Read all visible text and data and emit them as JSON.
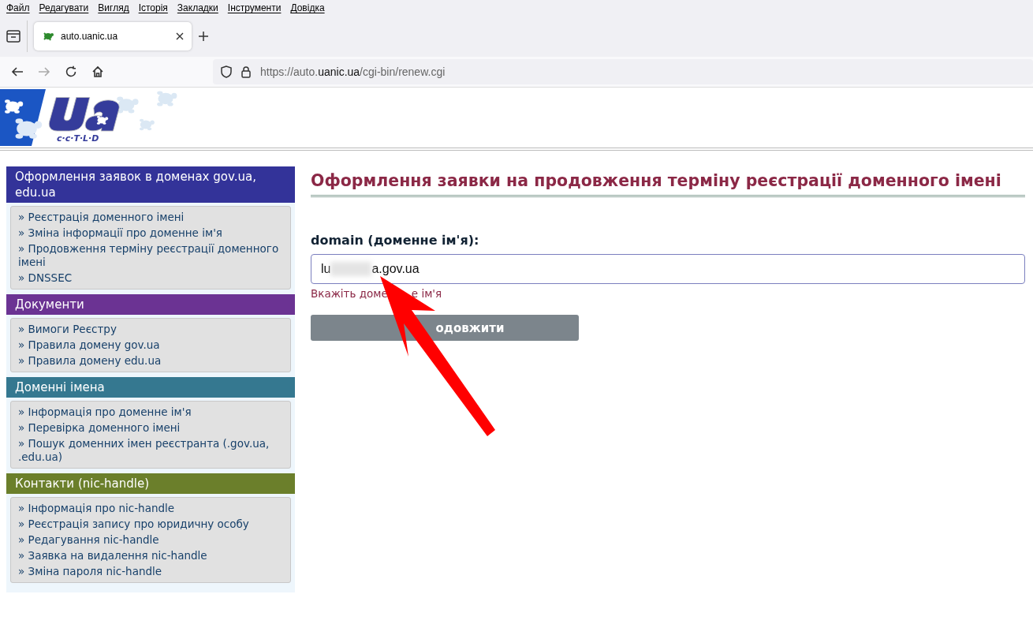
{
  "menu_bar": [
    "Файл",
    "Редагувати",
    "Вигляд",
    "Історія",
    "Закладки",
    "Інструменти",
    "Довідка"
  ],
  "tabs": [
    {
      "title": "auto.uanic.ua",
      "selected": true
    }
  ],
  "address_bar": {
    "url_prefix": "https://auto.",
    "url_domain": "uanic.ua",
    "url_path": "/cgi-bin/renew.cgi"
  },
  "logo": {
    "subtitle": "c·c·T·L·D"
  },
  "sidebar": [
    {
      "title": "Оформлення заявок в доменах gov.ua, edu.ua",
      "color": "#333399",
      "items": [
        "» Реєстрація доменного імені",
        "» Зміна інформації про доменне ім'я",
        "» Продовження терміну реєстрації доменного імені",
        "» DNSSEC"
      ]
    },
    {
      "title": "Документи",
      "color": "#6b3393",
      "items": [
        "» Вимоги Реєстру",
        "» Правила домену gov.ua",
        "» Правила домену edu.ua"
      ]
    },
    {
      "title": "Доменні імена",
      "color": "#357890",
      "items": [
        "» Інформація про доменне ім'я",
        "» Перевірка доменного імені",
        "» Пошук доменних імен реєстранта (.gov.ua, .edu.ua)"
      ]
    },
    {
      "title": "Контакти (nic-handle)",
      "color": "#6b7f2b",
      "items": [
        "» Інформація про nic-handle",
        "» Реєстрація запису про юридичну особу",
        "» Редагування nic-handle",
        "» Заявка на видалення nic-handle",
        "» Зміна пароля nic-handle"
      ]
    }
  ],
  "main": {
    "title": "Оформлення заявки на продовження терміну реєстрації доменного імені",
    "field_label": "domain (доменне ім'я):",
    "field_value_start": "lu",
    "field_value_end": "a.gov.ua",
    "redacted": true,
    "hint_start": "Вкажіть доме",
    "hint_end": "е ім'я",
    "button": "одовжити"
  }
}
